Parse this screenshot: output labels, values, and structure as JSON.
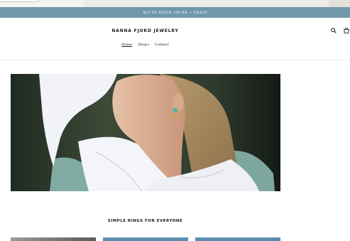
{
  "announcement": {
    "text": "ALT PÅ SIDEN 100 KR + FRAGT"
  },
  "header": {
    "logo": "NANNA FJORD JEWELRY",
    "search_icon": "search-icon",
    "cart_icon": "cart-icon"
  },
  "nav": {
    "items": [
      {
        "label": "Home",
        "active": true
      },
      {
        "label": "Shop",
        "has_dropdown": true
      },
      {
        "label": "Contact"
      }
    ]
  },
  "hero": {
    "alt": "Model in white shirt wearing turquoise hoop earring"
  },
  "collection": {
    "title": "SIMPLE RINGS FOR EVERYONE"
  },
  "colors": {
    "announcement_bg": "#6f98ac",
    "card_blue": "#5b8db0"
  }
}
